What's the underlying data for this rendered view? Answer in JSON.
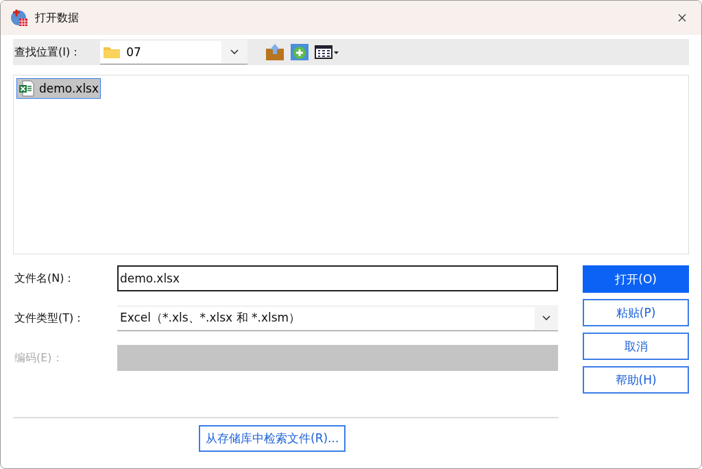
{
  "window": {
    "title": "打开数据"
  },
  "look_in": {
    "label": "查找位置(I)：",
    "value": "07"
  },
  "files": [
    {
      "name": "demo.xlsx",
      "selected": true
    }
  ],
  "form": [
    {
      "kind": "text",
      "label": "文件名(N)：",
      "value": "demo.xlsx",
      "disabled": false
    },
    {
      "kind": "select",
      "label": "文件类型(T)：",
      "value": "Excel（*.xls、*.xlsx 和 *.xlsm）",
      "disabled": false
    },
    {
      "kind": "blank",
      "label": "编码(E)：",
      "disabled": true
    }
  ],
  "buttons": [
    {
      "label": "打开(O)",
      "default": true
    },
    {
      "label": "粘贴(P)",
      "default": false
    },
    {
      "label": "取消",
      "default": false
    },
    {
      "label": "帮助(H)",
      "default": false
    }
  ],
  "repository_button": "从存储库中检索文件(R)..."
}
